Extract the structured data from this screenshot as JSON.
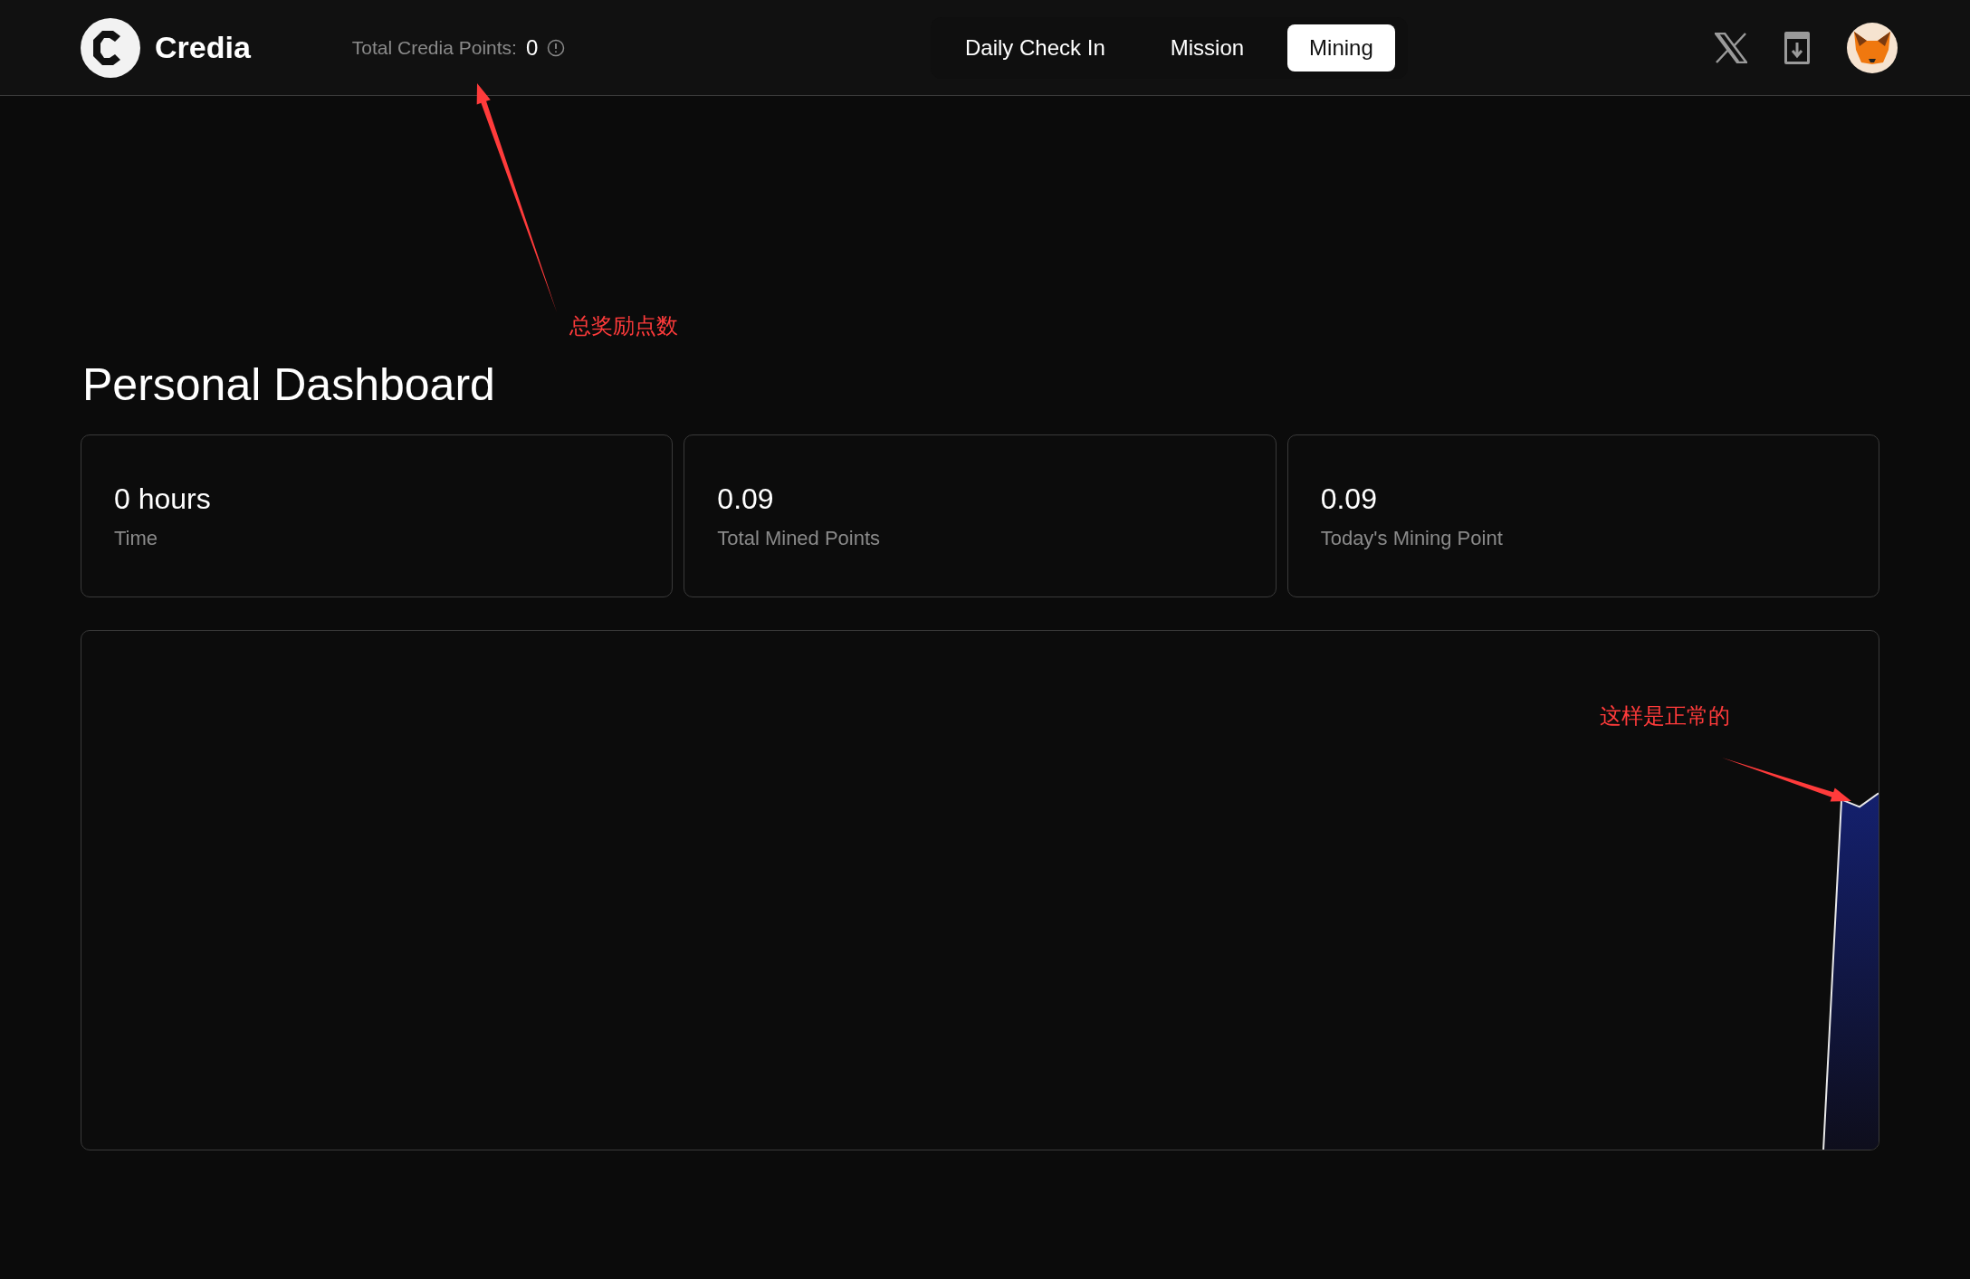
{
  "header": {
    "brand": "Credia",
    "points_label": "Total Credia Points:",
    "points_value": "0",
    "nav": [
      {
        "label": "Daily Check In",
        "selected": false
      },
      {
        "label": "Mission",
        "selected": false
      },
      {
        "label": "Mining",
        "selected": true
      }
    ]
  },
  "dashboard": {
    "title": "Personal Dashboard",
    "stats": [
      {
        "value": "0 hours",
        "label": "Time"
      },
      {
        "value": "0.09",
        "label": "Total Mined Points"
      },
      {
        "value": "0.09",
        "label": "Today's Mining Point"
      }
    ]
  },
  "annotations": [
    {
      "text": "总奖励点数"
    },
    {
      "text": "这样是正常的"
    }
  ]
}
